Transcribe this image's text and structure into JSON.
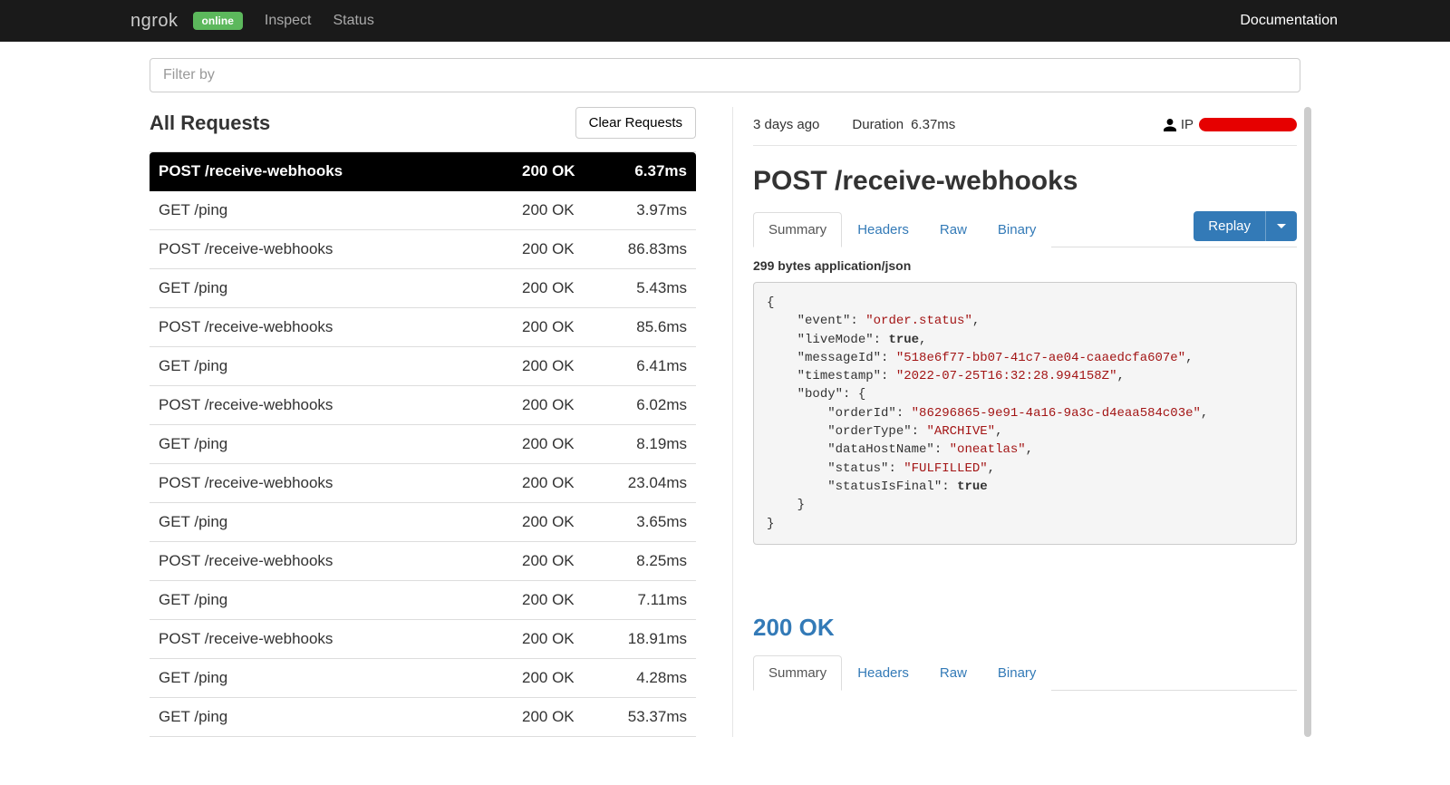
{
  "nav": {
    "brand": "ngrok",
    "status_badge": "online",
    "links": {
      "inspect": "Inspect",
      "status": "Status",
      "docs": "Documentation"
    }
  },
  "filter": {
    "placeholder": "Filter by"
  },
  "requests": {
    "title": "All Requests",
    "clear_label": "Clear Requests",
    "items": [
      {
        "method": "POST",
        "path": "/receive-webhooks",
        "status": "200 OK",
        "duration": "6.37ms",
        "selected": true
      },
      {
        "method": "GET",
        "path": "/ping",
        "status": "200 OK",
        "duration": "3.97ms"
      },
      {
        "method": "POST",
        "path": "/receive-webhooks",
        "status": "200 OK",
        "duration": "86.83ms"
      },
      {
        "method": "GET",
        "path": "/ping",
        "status": "200 OK",
        "duration": "5.43ms"
      },
      {
        "method": "POST",
        "path": "/receive-webhooks",
        "status": "200 OK",
        "duration": "85.6ms"
      },
      {
        "method": "GET",
        "path": "/ping",
        "status": "200 OK",
        "duration": "6.41ms"
      },
      {
        "method": "POST",
        "path": "/receive-webhooks",
        "status": "200 OK",
        "duration": "6.02ms"
      },
      {
        "method": "GET",
        "path": "/ping",
        "status": "200 OK",
        "duration": "8.19ms"
      },
      {
        "method": "POST",
        "path": "/receive-webhooks",
        "status": "200 OK",
        "duration": "23.04ms"
      },
      {
        "method": "GET",
        "path": "/ping",
        "status": "200 OK",
        "duration": "3.65ms"
      },
      {
        "method": "POST",
        "path": "/receive-webhooks",
        "status": "200 OK",
        "duration": "8.25ms"
      },
      {
        "method": "GET",
        "path": "/ping",
        "status": "200 OK",
        "duration": "7.11ms"
      },
      {
        "method": "POST",
        "path": "/receive-webhooks",
        "status": "200 OK",
        "duration": "18.91ms"
      },
      {
        "method": "GET",
        "path": "/ping",
        "status": "200 OK",
        "duration": "4.28ms"
      },
      {
        "method": "GET",
        "path": "/ping",
        "status": "200 OK",
        "duration": "53.37ms"
      }
    ]
  },
  "detail": {
    "age": "3 days ago",
    "duration_label": "Duration",
    "duration_value": "6.37ms",
    "ip_label": "IP",
    "title": "POST /receive-webhooks",
    "tabs": {
      "summary": "Summary",
      "headers": "Headers",
      "raw": "Raw",
      "binary": "Binary"
    },
    "replay_label": "Replay",
    "content_type": "299 bytes application/json",
    "payload": {
      "event": "order.status",
      "liveMode": true,
      "messageId": "518e6f77-bb07-41c7-ae04-caaedcfa607e",
      "timestamp": "2022-07-25T16:32:28.994158Z",
      "body": {
        "orderId": "86296865-9e91-4a16-9a3c-d4eaa584c03e",
        "orderType": "ARCHIVE",
        "dataHostName": "oneatlas",
        "status": "FULFILLED",
        "statusIsFinal": true
      }
    },
    "response_status": "200 OK"
  }
}
